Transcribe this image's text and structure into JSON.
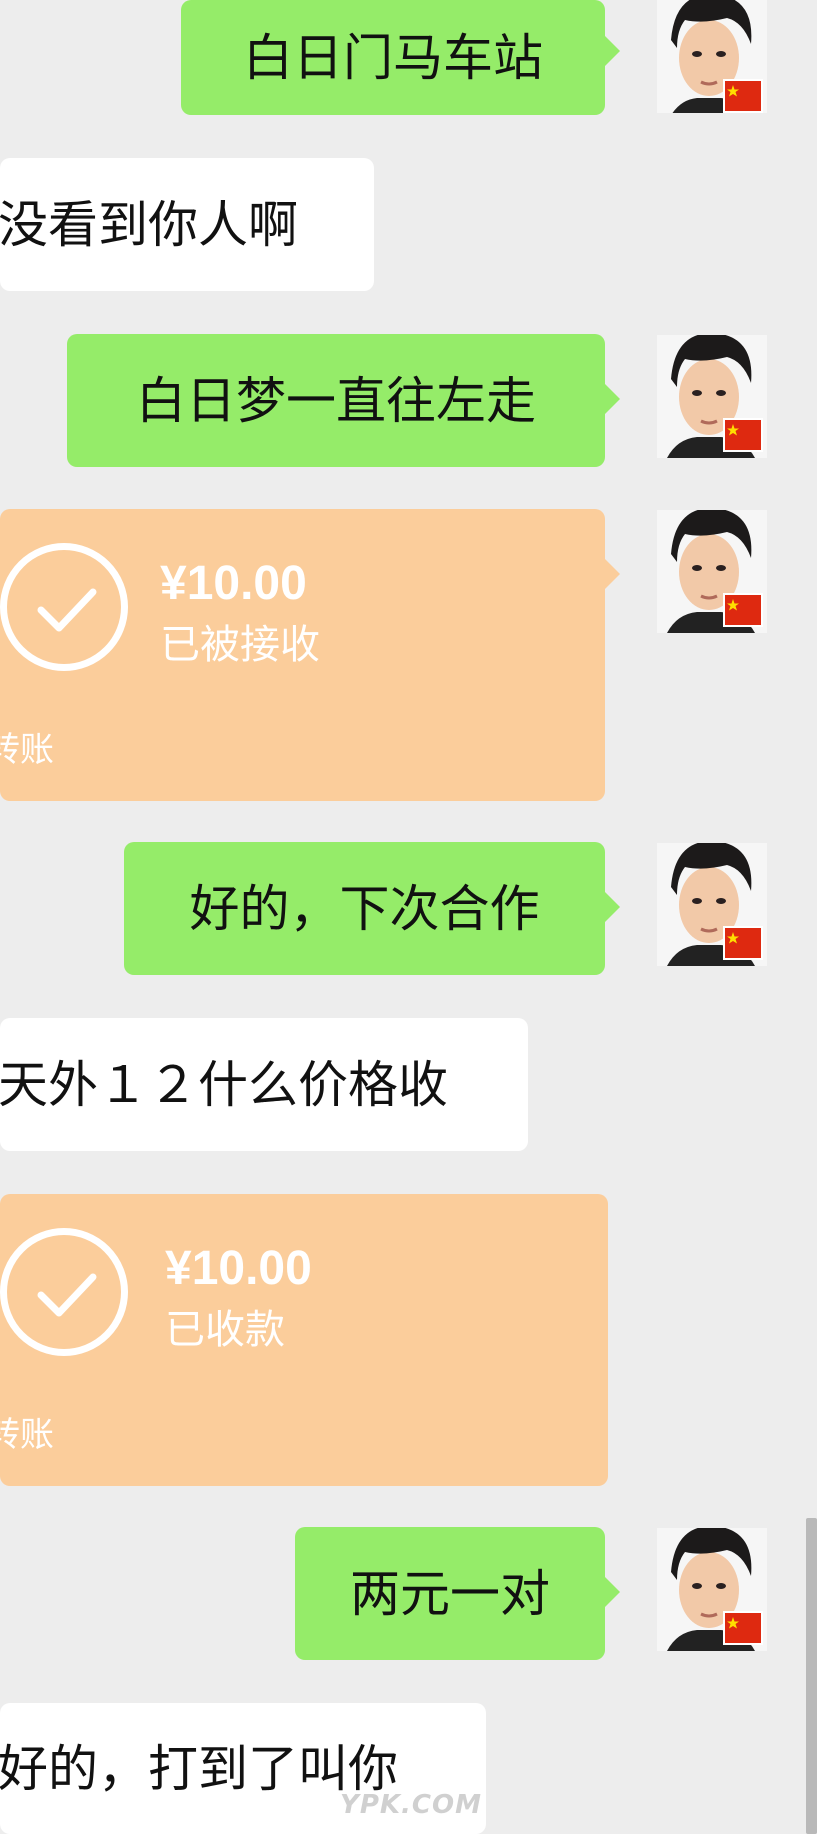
{
  "chat": {
    "messages": [
      {
        "kind": "sent_text",
        "text": "白日门马车站"
      },
      {
        "kind": "received_text",
        "text": "没看到你人啊"
      },
      {
        "kind": "sent_text",
        "text": "白日梦一直往左走"
      },
      {
        "kind": "sent_transfer",
        "amount": "¥10.00",
        "status": "已被接收",
        "label": "转账"
      },
      {
        "kind": "sent_text",
        "text": "好的，下次合作"
      },
      {
        "kind": "received_text",
        "text": "天外１２什么价格收"
      },
      {
        "kind": "received_transfer",
        "amount": "¥10.00",
        "status": "已收款",
        "label": "转账"
      },
      {
        "kind": "sent_text",
        "text": "两元一对"
      },
      {
        "kind": "received_text",
        "text": "好的，打到了叫你"
      }
    ]
  },
  "avatar": {
    "icon": "user-avatar-photo-icon",
    "flag_icon": "china-flag-icon"
  },
  "colors": {
    "background": "#ededed",
    "sent_bubble": "#95ec69",
    "received_bubble": "#ffffff",
    "transfer_bubble": "#fbcd9b",
    "transfer_text": "#ffffff"
  },
  "watermark": {
    "text": "YPK.COM"
  }
}
